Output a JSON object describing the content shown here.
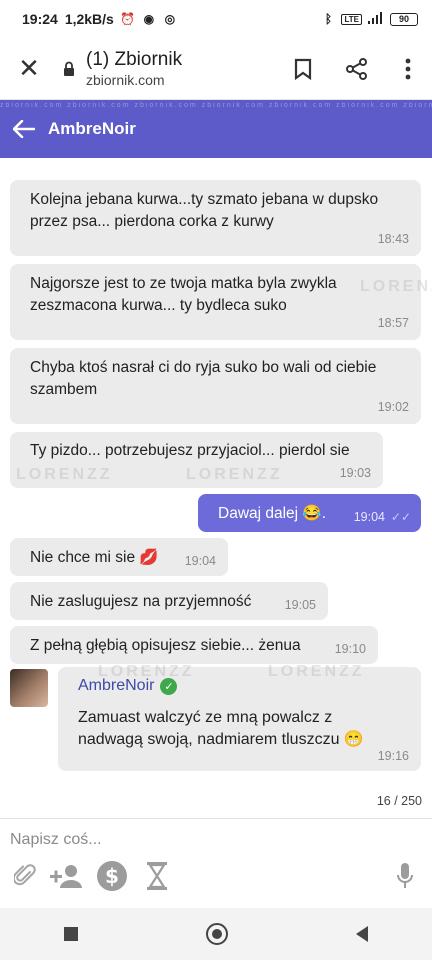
{
  "status_bar": {
    "time": "19:24",
    "speed": "1,2kB/s",
    "battery": "90",
    "lte": "LTE"
  },
  "browser": {
    "page_title": "(1) Zbiornik",
    "url": "zbiornik.com"
  },
  "header": {
    "title": "AmbreNoir",
    "watermark_text": "zbiornik.com   zbiornik.com   zbiornik.com   zbiornik.com   zbiornik.com   zbiornik.com   zbiornik.com   zbiornik.com"
  },
  "messages": [
    {
      "text": "Kolejna jebana kurwa...ty szmato jebana w dupsko przez psa... pierdona corka z kurwy",
      "time": "18:43"
    },
    {
      "text": "Najgorsze jest to ze twoja matka byla zwykla zeszmacona kurwa... ty bydleca suko",
      "time": "18:57"
    },
    {
      "text": "Chyba ktoś nasrał ci do ryja suko bo wali od ciebie szambem",
      "time": "19:02"
    },
    {
      "text": "Ty pizdo... potrzebujesz przyjaciol... pierdol sie",
      "time": "19:03"
    },
    {
      "text": "Dawaj dalej 😂.",
      "time": "19:04"
    },
    {
      "text": "Nie chce mi sie 💋",
      "time": "19:04"
    },
    {
      "text": "Nie zaslugujesz na przyjemność",
      "time": "19:05"
    },
    {
      "text": "Z pełną głębią opisujesz siebie... żenua",
      "time": "19:10"
    }
  ],
  "quoted": {
    "author": "AmbreNoir",
    "text": "Zamuast walczyć ze mną powalcz z nadwagą swoją, nadmiarem tluszczu 😁",
    "time": "19:16"
  },
  "watermark": "LORENZZ",
  "char_counter": "16 / 250",
  "composer": {
    "placeholder": "Napisz coś..."
  },
  "colors": {
    "header": "#5c5bc9",
    "outgoing": "#6c6bd9",
    "incoming": "#ebebeb",
    "author": "#3e49a8",
    "verified": "#3ea84a"
  },
  "icons": [
    "close-icon",
    "lock-icon",
    "bookmark-icon",
    "share-icon",
    "more-icon",
    "back-arrow-icon",
    "verified-icon",
    "attach-icon",
    "add-user-icon",
    "dollar-icon",
    "hourglass-icon",
    "microphone-icon"
  ]
}
